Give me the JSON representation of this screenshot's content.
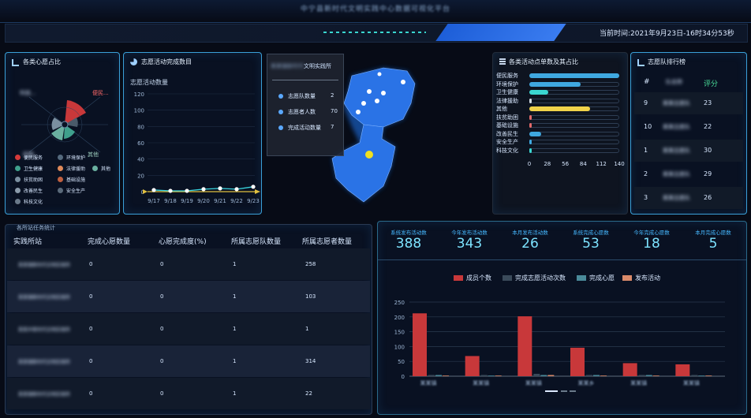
{
  "header": {
    "title": "中宁县新时代文明实践中心数据可视化平台",
    "time_label": "当前时间:",
    "time_value": "2021年9月23日-16时34分53秒"
  },
  "panels": {
    "wish_ratio": {
      "title": "各类心愿占比",
      "ring_labels": [
        "科技...",
        "便民...",
        "其他",
        "技能..."
      ],
      "legend": [
        {
          "label": "便民服务",
          "color": "#d63a3a"
        },
        {
          "label": "环境保护",
          "color": "#556a7e"
        },
        {
          "label": "卫生健康",
          "color": "#3fa08c"
        },
        {
          "label": "法律援助",
          "color": "#e08a5a"
        },
        {
          "label": "其他",
          "color": "#6ab0a0"
        },
        {
          "label": "扶贫助困",
          "color": "#7a8fa0"
        },
        {
          "label": "基础设施",
          "color": "#c06040"
        },
        {
          "label": "改善民生",
          "color": "#8a9aaa"
        },
        {
          "label": "安全生产",
          "color": "#5a6a7a"
        },
        {
          "label": "科技文化",
          "color": "#6a7a8a"
        }
      ]
    },
    "volunteer_done": {
      "title": "志愿活动完成数目",
      "subtitle": "志愿活动数量",
      "chart_data": {
        "type": "line",
        "x": [
          "9/17",
          "9/18",
          "9/19",
          "9/20",
          "9/21",
          "9/22",
          "9/23"
        ],
        "values": [
          2,
          1,
          1,
          3,
          4,
          3,
          6
        ],
        "ylim": [
          0,
          120
        ],
        "yticks": [
          0,
          20,
          40,
          60,
          80,
          100,
          120
        ]
      }
    },
    "map_info": {
      "title": "文明实践所",
      "rows": [
        {
          "label": "志愿队数量",
          "value": "2"
        },
        {
          "label": "志愿者人数",
          "value": "70"
        },
        {
          "label": "完成活动数量",
          "value": "7"
        }
      ]
    },
    "activity_ratio": {
      "title": "各类活动点单数及其占比",
      "chart_data": {
        "type": "bar",
        "orientation": "horizontal",
        "categories": [
          "便民服务",
          "环境保护",
          "卫生健康",
          "法律援助",
          "其他",
          "扶贫助困",
          "基础设施",
          "改善民生",
          "安全生产",
          "科技文化"
        ],
        "values": [
          140,
          80,
          30,
          2,
          95,
          3,
          3,
          18,
          2,
          2
        ],
        "colors": [
          "#3fa8e0",
          "#3fa8e0",
          "#3ad6d0",
          "#cfd8e0",
          "#f0d24a",
          "#e26a6a",
          "#e26a6a",
          "#3fa8e0",
          "#3fa8e0",
          "#3ad6d0"
        ],
        "xlim": [
          0,
          140
        ],
        "xticks": [
          0,
          28,
          56,
          84,
          112,
          140
        ]
      }
    },
    "team_rank": {
      "title": "志愿队排行榜",
      "head_rank": "#",
      "head_name": "队名称",
      "head_score": "评分",
      "rows": [
        {
          "rank": "9",
          "name": "某某志愿队",
          "score": "23"
        },
        {
          "rank": "10",
          "name": "某某志愿队",
          "score": "22"
        },
        {
          "rank": "1",
          "name": "某某志愿队",
          "score": "30"
        },
        {
          "rank": "2",
          "name": "某某志愿队",
          "score": "29"
        },
        {
          "rank": "3",
          "name": "某某志愿队",
          "score": "26"
        }
      ]
    },
    "station_stats": {
      "title": "各所站任务统计",
      "headers": [
        "实践所站",
        "完成心愿数量",
        "心愿完成度(%)",
        "所属志愿队数量",
        "所属志愿者数量"
      ],
      "rows": [
        {
          "name": "某某镇新时代文明实践所",
          "done": "0",
          "rate": "0",
          "teams": "1",
          "volunteers": "258"
        },
        {
          "name": "某某镇新时代文明实践所",
          "done": "0",
          "rate": "0",
          "teams": "1",
          "volunteers": "103"
        },
        {
          "name": "某某乡新时代文明实践所",
          "done": "0",
          "rate": "0",
          "teams": "1",
          "volunteers": "1"
        },
        {
          "name": "某某镇新时代文明实践所",
          "done": "0",
          "rate": "0",
          "teams": "1",
          "volunteers": "314"
        },
        {
          "name": "某某镇新时代文明实践所",
          "done": "0",
          "rate": "0",
          "teams": "1",
          "volunteers": "22"
        }
      ]
    },
    "summary": {
      "stats": [
        {
          "label": "系统发布活动数",
          "value": "388"
        },
        {
          "label": "今年发布活动数",
          "value": "343"
        },
        {
          "label": "本月发布活动数",
          "value": "26"
        },
        {
          "label": "系统完成心愿数",
          "value": "53"
        },
        {
          "label": "今年完成心愿数",
          "value": "18"
        },
        {
          "label": "本月完成心愿数",
          "value": "5"
        }
      ],
      "chart_data": {
        "type": "bar",
        "categories": [
          "某某镇",
          "某某镇",
          "某某镇",
          "某某乡",
          "某某镇",
          "某某镇"
        ],
        "series": [
          {
            "name": "成员个数",
            "color": "#c8383a",
            "values": [
              212,
              68,
              202,
              96,
              44,
              40
            ]
          },
          {
            "name": "完成志愿活动次数",
            "color": "#3a4a5a",
            "values": [
              2,
              1,
              8,
              3,
              1,
              1
            ]
          },
          {
            "name": "完成心愿",
            "color": "#4a8a9a",
            "values": [
              1,
              0,
              4,
              2,
              2,
              0
            ]
          },
          {
            "name": "发布活动",
            "color": "#d98a6a",
            "values": [
              0,
              0,
              1,
              0,
              0,
              0
            ]
          }
        ],
        "ylim": [
          0,
          250
        ],
        "yticks": [
          0,
          50,
          100,
          150,
          200,
          250
        ]
      }
    }
  }
}
